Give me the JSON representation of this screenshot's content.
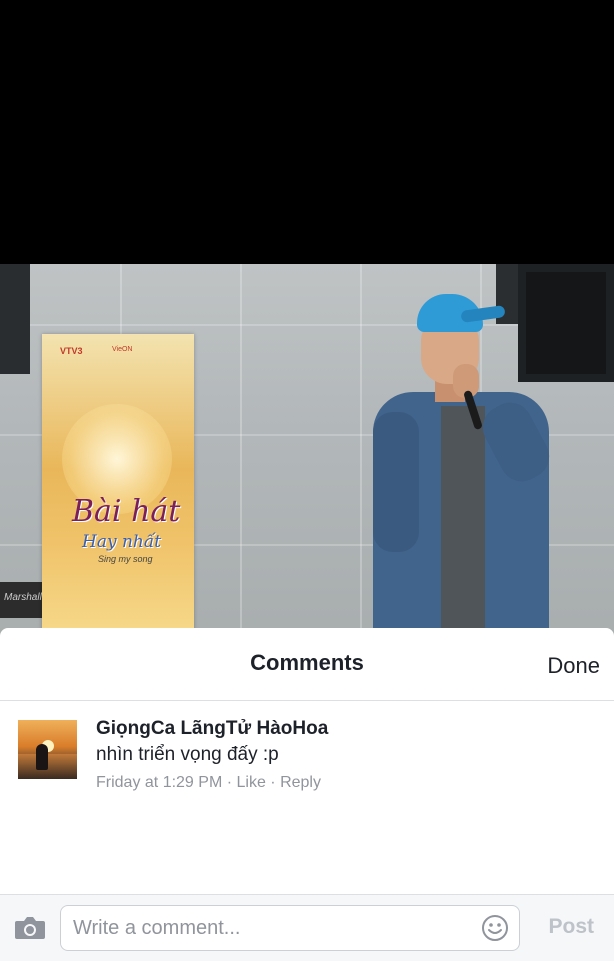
{
  "photo": {
    "banner_logo": "VTV3",
    "banner_logo2": "VieON",
    "banner_title_line1": "Bài hát",
    "banner_title_line2": "Hay nhất",
    "banner_title_line3": "Sing my song",
    "amp_brand": "Marshall"
  },
  "comments_sheet": {
    "title": "Comments",
    "done_label": "Done",
    "comments": [
      {
        "author": "GiọngCa LãngTử HàoHoa",
        "text": "nhìn triển vọng đấy :p",
        "time": "Friday at 1:29 PM",
        "separator": " · ",
        "like_label": "Like",
        "reply_label": "Reply"
      }
    ]
  },
  "composer": {
    "placeholder": "Write a comment...",
    "post_label": "Post",
    "post_color": "#bec3c9"
  },
  "colors": {
    "text_primary": "#1d2129",
    "text_secondary": "#90949c",
    "divider": "#dddfe2"
  }
}
